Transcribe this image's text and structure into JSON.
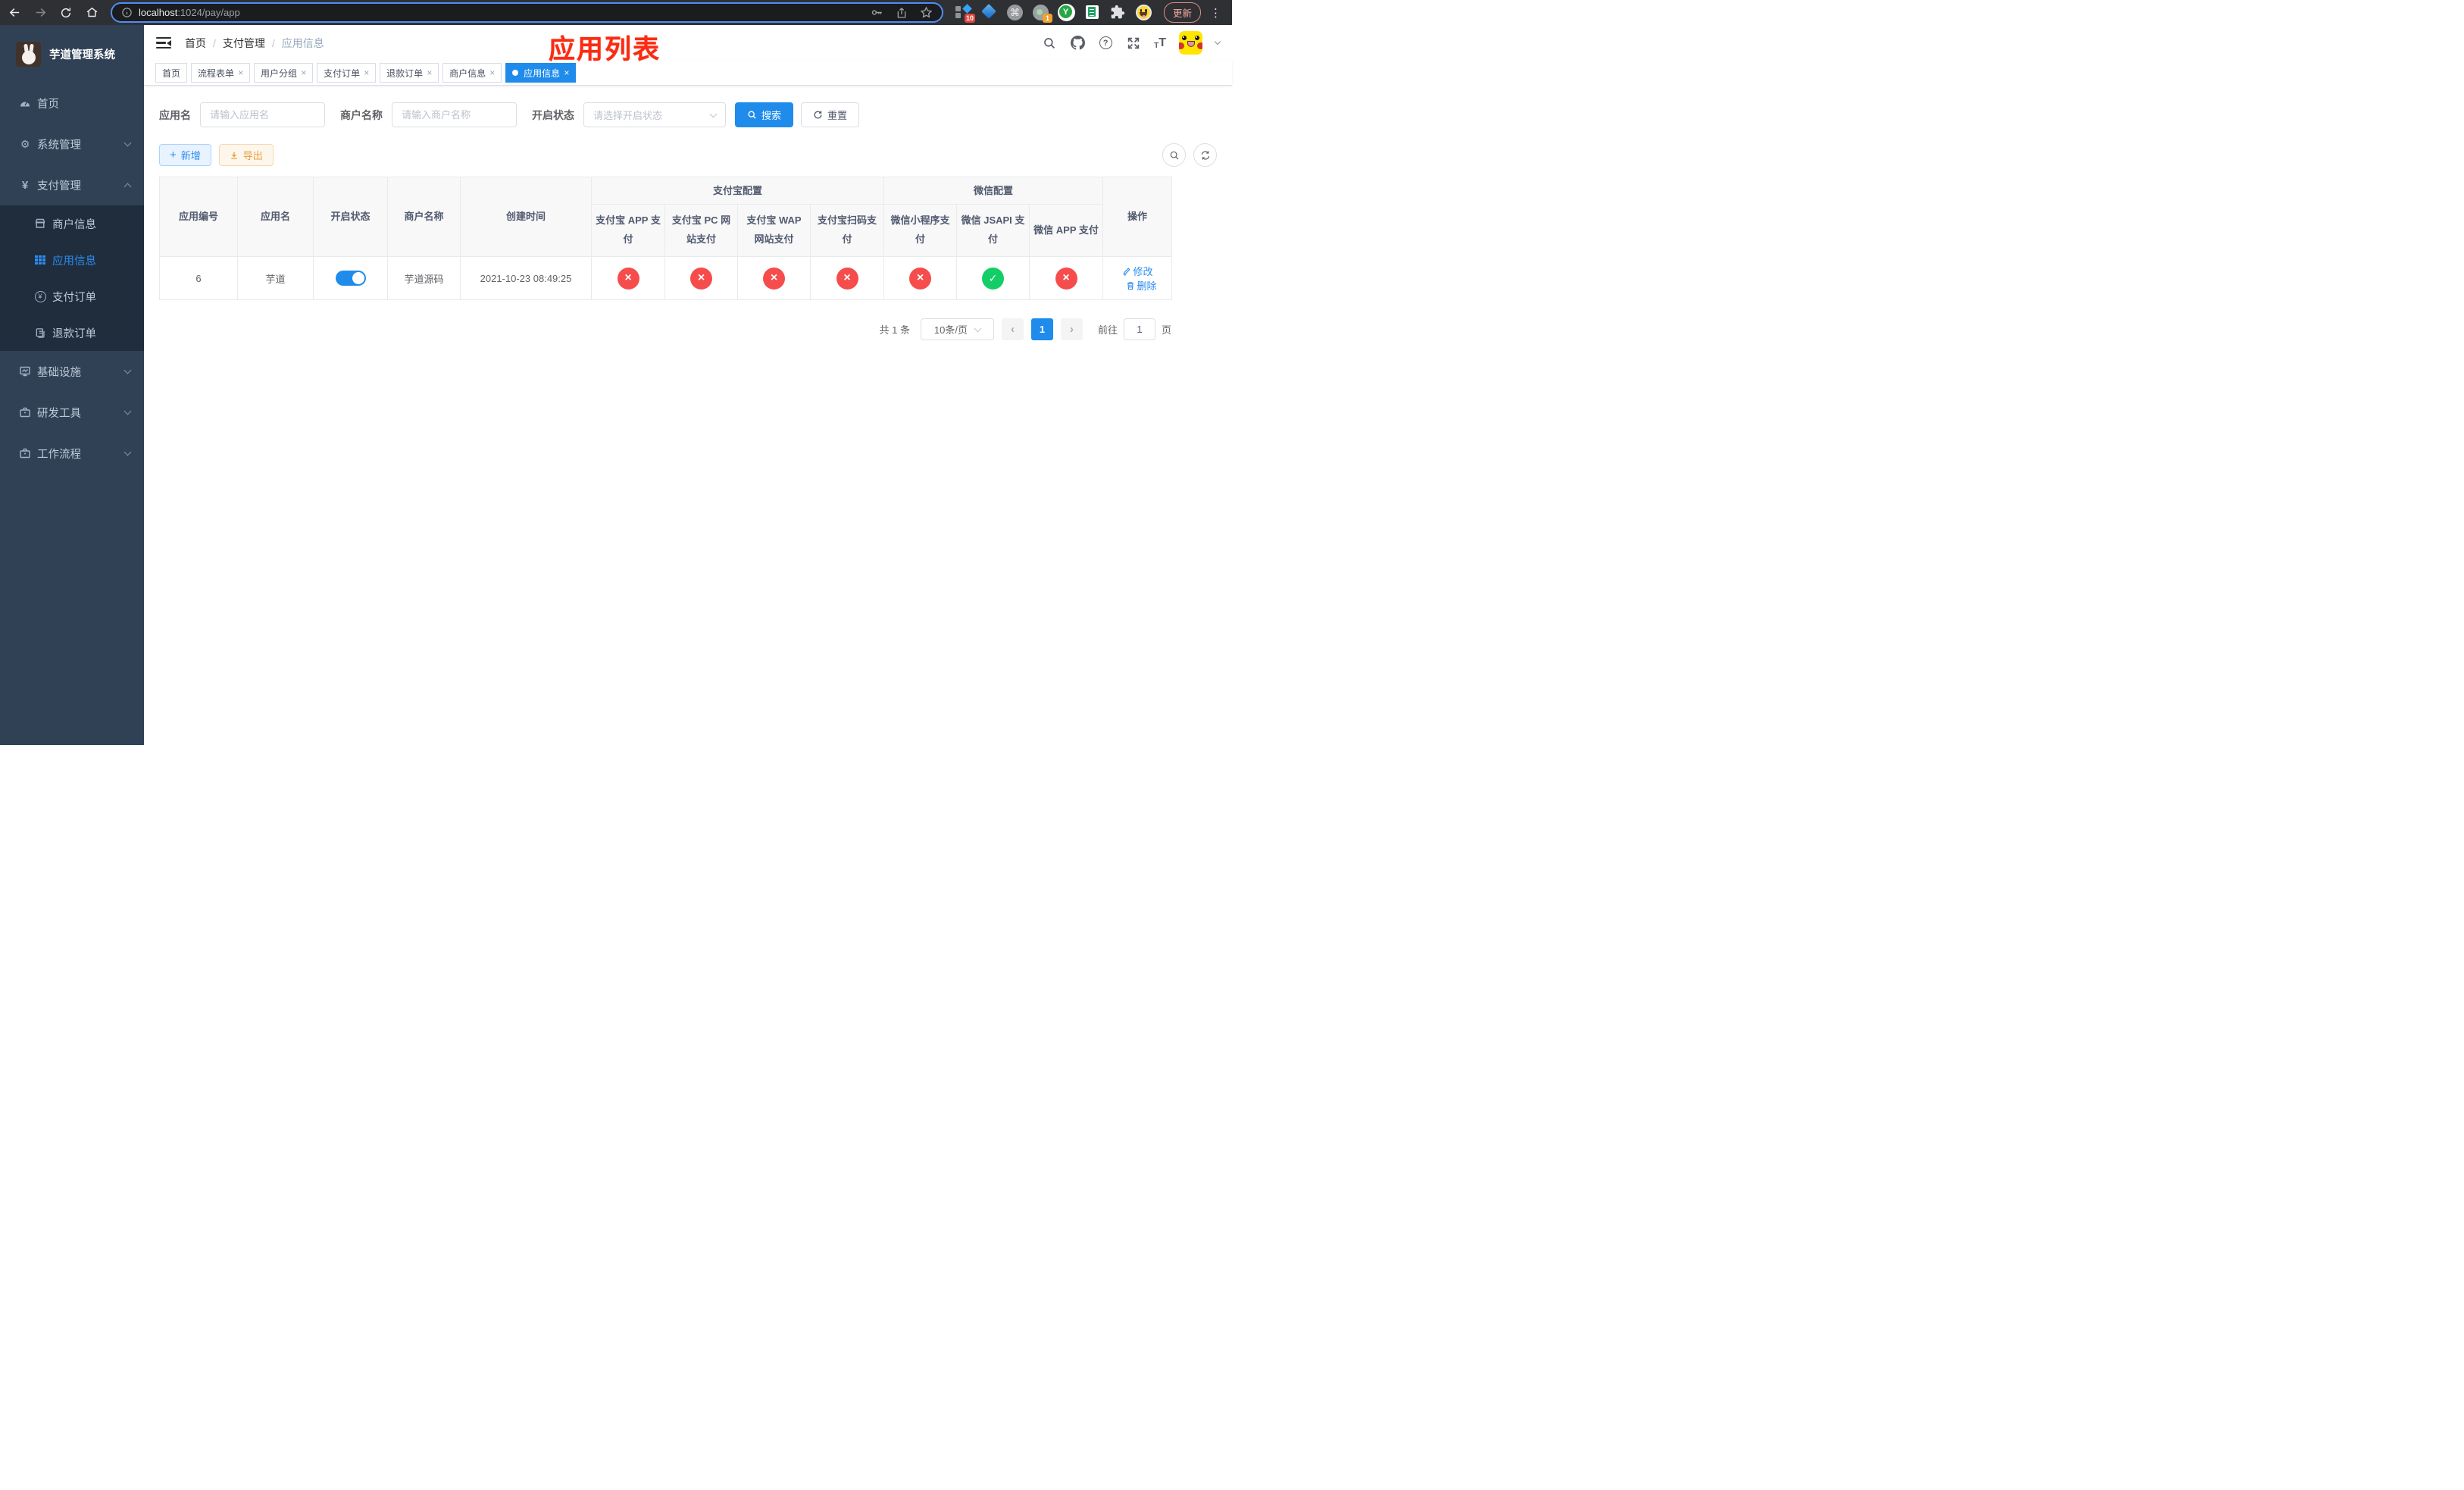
{
  "browser": {
    "url_host": "localhost",
    "url_rest": ":1024/pay/app",
    "update_label": "更新",
    "extensions": [
      {
        "name": "blocks-extension",
        "badge": "10"
      },
      {
        "name": "kite-extension",
        "badge": ""
      },
      {
        "name": "command-extension",
        "badge": ""
      },
      {
        "name": "recorder-extension",
        "badge": "1"
      },
      {
        "name": "y-extension",
        "badge": ""
      },
      {
        "name": "notes-extension",
        "badge": ""
      },
      {
        "name": "puzzle-extension",
        "badge": ""
      },
      {
        "name": "emoji-extension",
        "badge": ""
      }
    ]
  },
  "sidebar": {
    "title": "芋道管理系统",
    "top": [
      {
        "label": "首页"
      },
      {
        "label": "系统管理"
      },
      {
        "label": "支付管理"
      }
    ],
    "sub": [
      {
        "label": "商户信息"
      },
      {
        "label": "应用信息",
        "active": true
      },
      {
        "label": "支付订单"
      },
      {
        "label": "退款订单"
      }
    ],
    "bottom": [
      {
        "label": "基础设施"
      },
      {
        "label": "研发工具"
      },
      {
        "label": "工作流程"
      }
    ]
  },
  "navbar": {
    "breadcrumb": [
      "首页",
      "支付管理",
      "应用信息"
    ],
    "annotation": "应用列表"
  },
  "tags": [
    {
      "label": "首页",
      "closable": false,
      "active": false
    },
    {
      "label": "流程表单",
      "closable": true,
      "active": false
    },
    {
      "label": "用户分组",
      "closable": true,
      "active": false
    },
    {
      "label": "支付订单",
      "closable": true,
      "active": false
    },
    {
      "label": "退款订单",
      "closable": true,
      "active": false
    },
    {
      "label": "商户信息",
      "closable": true,
      "active": false
    },
    {
      "label": "应用信息",
      "closable": true,
      "active": true
    }
  ],
  "filters": {
    "app_name_label": "应用名",
    "app_name_placeholder": "请输入应用名",
    "merchant_label": "商户名称",
    "merchant_placeholder": "请输入商户名称",
    "status_label": "开启状态",
    "status_placeholder": "请选择开启状态",
    "search_label": "搜索",
    "reset_label": "重置"
  },
  "toolbar": {
    "add_label": "新增",
    "export_label": "导出"
  },
  "table": {
    "group_headers": {
      "alipay": "支付宝配置",
      "wechat": "微信配置"
    },
    "columns": {
      "app_id": "应用编号",
      "app_name": "应用名",
      "status": "开启状态",
      "merchant": "商户名称",
      "created": "创建时间",
      "ops": "操作"
    },
    "sub_columns": [
      "支付宝 APP 支付",
      "支付宝 PC 网站支付",
      "支付宝 WAP 网站支付",
      "支付宝扫码支付",
      "微信小程序支付",
      "微信 JSAPI 支付",
      "微信 APP 支付"
    ],
    "row": {
      "app_id": "6",
      "app_name": "芋道",
      "enabled": true,
      "merchant": "芋道源码",
      "created": "2021-10-23 08:49:25",
      "pay_channels": [
        "disabled",
        "disabled",
        "disabled",
        "disabled",
        "disabled",
        "enabled",
        "disabled"
      ],
      "edit_label": "修改",
      "delete_label": "删除"
    }
  },
  "pagination": {
    "total": "共 1 条",
    "per_page": "10条/页",
    "page": "1",
    "goto_prefix": "前往",
    "goto_value": "1",
    "goto_suffix": "页"
  },
  "colors": {
    "primary": "#1f8ceb",
    "link": "#2d8cf0",
    "success": "#13ce66",
    "danger": "#f64c4c",
    "warning": "#e6a23c",
    "sidebar_bg": "#304156",
    "submenu_bg": "#1f2d3d",
    "sidebar_text": "#bfcbd9",
    "annotation_red": "#fb2b12"
  }
}
